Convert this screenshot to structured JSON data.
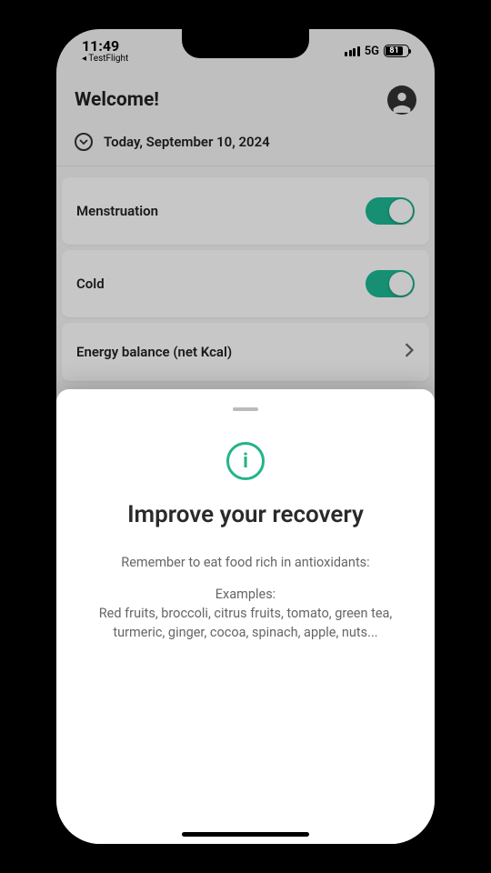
{
  "status": {
    "time": "11:49",
    "back_app": "◂ TestFlight",
    "network": "5G",
    "battery": "81"
  },
  "header": {
    "title": "Welcome!",
    "date": "Today, September 10, 2024"
  },
  "cards": [
    {
      "label": "Menstruation",
      "type": "toggle",
      "on": true
    },
    {
      "label": "Cold",
      "type": "toggle",
      "on": true
    },
    {
      "label": "Energy balance (net Kcal)",
      "type": "nav"
    }
  ],
  "sheet": {
    "title": "Improve your recovery",
    "line1": "Remember to eat food rich in antioxidants:",
    "examples_label": "Examples:",
    "examples": "Red fruits, broccoli, citrus fruits, tomato, green tea, turmeric, ginger, cocoa, spinach, apple, nuts..."
  }
}
